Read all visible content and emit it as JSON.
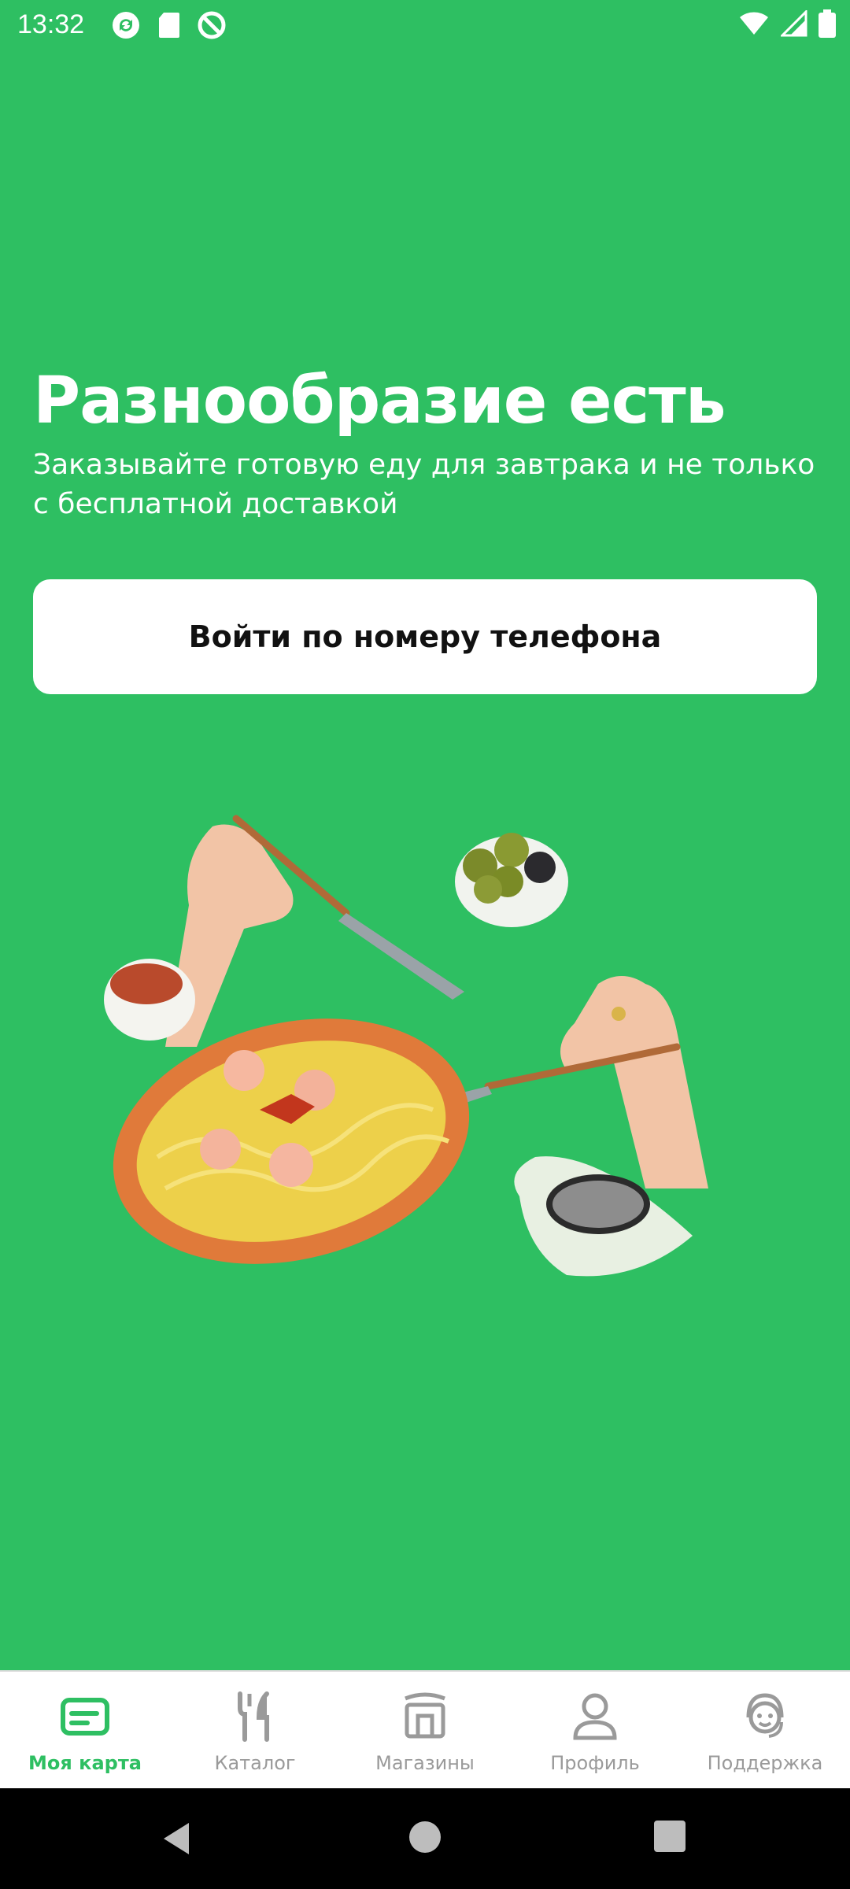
{
  "status_bar": {
    "time": "13:32",
    "left_icons": [
      "sync-icon",
      "sd-card-icon",
      "no-disturb-icon"
    ],
    "right_icons": [
      "wifi-icon",
      "signal-icon",
      "battery-icon"
    ]
  },
  "hero": {
    "title": "Разнообразие есть",
    "subtitle": "Заказывайте готовую еду для завтрака и не только с бесплатной доставкой"
  },
  "login_button": {
    "label": "Войти по номеру телефона"
  },
  "bottom_nav": {
    "items": [
      {
        "label": "Моя карта",
        "icon": "card-icon",
        "active": true
      },
      {
        "label": "Каталог",
        "icon": "fork-knife-icon",
        "active": false
      },
      {
        "label": "Магазины",
        "icon": "store-icon",
        "active": false
      },
      {
        "label": "Профиль",
        "icon": "user-icon",
        "active": false
      },
      {
        "label": "Поддержка",
        "icon": "support-icon",
        "active": false
      }
    ]
  },
  "system_nav": {
    "buttons": [
      "back-icon",
      "home-icon",
      "recents-icon"
    ]
  },
  "colors": {
    "background": "#2ebf62",
    "accent": "#2ebf62",
    "inactive": "#9a9a9a"
  }
}
